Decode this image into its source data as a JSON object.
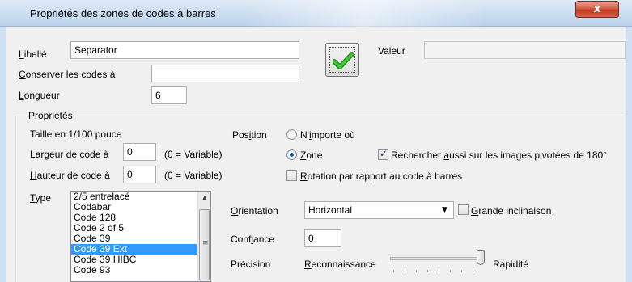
{
  "window": {
    "title": "Propriétés des zones de codes à barres",
    "close_glyph": "x"
  },
  "fields": {
    "libelle": {
      "label_accel": "L",
      "label_rest": "ibellé",
      "value": "Separator"
    },
    "conserver": {
      "label_accel": "C",
      "label_rest": "onserver les codes à",
      "value": ""
    },
    "longueur": {
      "label_accel": "L",
      "label_rest": "ongueur",
      "value": "6"
    },
    "valeur": {
      "label": "Valeur",
      "value": ""
    }
  },
  "ok_button": {
    "icon": "green-checkmark-icon",
    "color": "#2db31f"
  },
  "properties": {
    "group_label": "Propriétés",
    "taille_label": "Taille en 1/100 pouce",
    "largeur": {
      "label": "Largeur de code à",
      "value": "0",
      "note": "(0 = Variable)"
    },
    "hauteur": {
      "label_accel": "H",
      "label_rest": "auteur de code à",
      "value": "0",
      "note": "(0 = Variable)"
    },
    "type": {
      "label_accel": "T",
      "label_rest": "ype"
    },
    "position": {
      "label_pre": "Pos",
      "label_accel": "i",
      "label_post": "tion",
      "options": [
        {
          "text_pre": "N'",
          "text_accel": "i",
          "text_post": "mporte où",
          "checked": false
        },
        {
          "text_pre": "",
          "text_accel": "Z",
          "text_post": "one",
          "checked": true
        }
      ]
    },
    "rechercher": {
      "text_pre": "Rechercher ",
      "text_accel": "a",
      "text_post": "ussi sur les images pivotées de 180°",
      "checked": true
    },
    "rotation": {
      "text_pre": "",
      "text_accel": "R",
      "text_post": "otation par rapport au code à barres",
      "checked": false
    },
    "orientation": {
      "label_accel": "O",
      "label_rest": "rientation",
      "value": "Horizontal"
    },
    "grande_inclinaison": {
      "text_pre": "",
      "text_accel": "G",
      "text_post": "rande inclinaison",
      "checked": false
    },
    "confiance": {
      "label_pre": "Conf",
      "label_accel": "i",
      "label_post": "ance",
      "value": "0"
    },
    "precision": {
      "label": "Précision",
      "left_label_accel": "R",
      "left_label_rest": "econnaissance",
      "right_label": "Rapidité",
      "level": 1.0
    },
    "type_list": {
      "items": [
        "2/5 entrelacé",
        "Codabar",
        "Code 128",
        "Code 2 of 5",
        "Code 39",
        "Code 39 Ext",
        "Code 39 HIBC",
        "Code 93"
      ],
      "selected_index": 5
    }
  }
}
